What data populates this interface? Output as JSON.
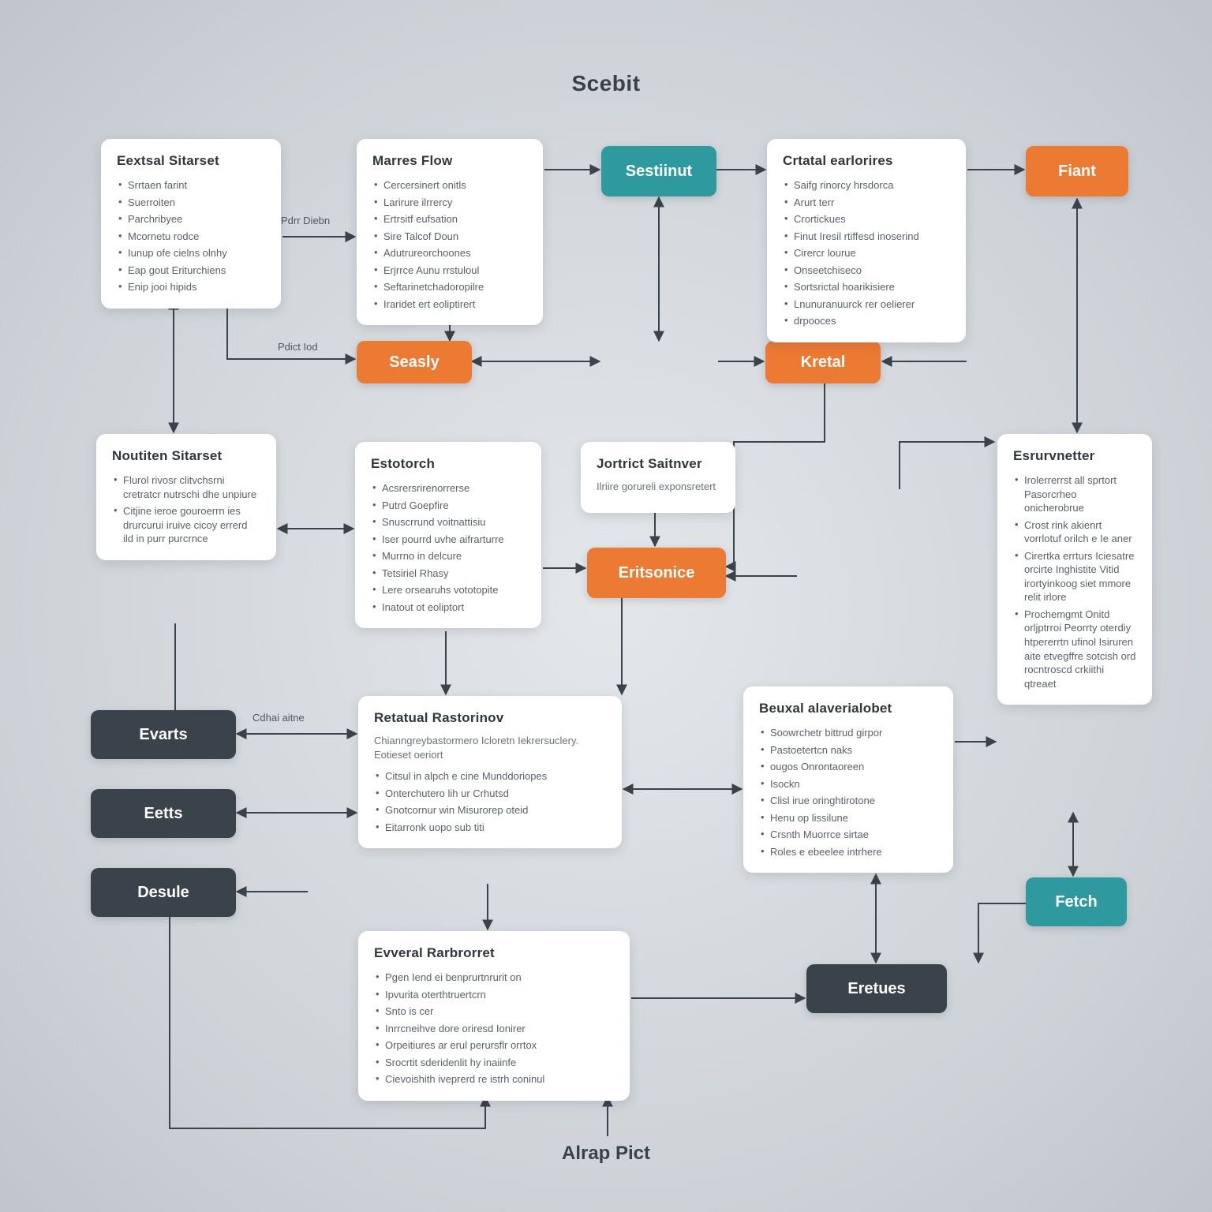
{
  "titles": {
    "top": "Scebit",
    "bottom": "Alrap Pict"
  },
  "edgeLabels": {
    "pdirDiebn": "Pdrr Diebn",
    "pdictIod": "Pdict Iod",
    "cdhaiAitne": "Cdhai aitne"
  },
  "chips": {
    "sestiinut": "Sestiinut",
    "fiant": "Fiant",
    "seasly": "Seasly",
    "kretal": "Kretal",
    "eritsonice": "Eritsonice",
    "evarts": "Evarts",
    "eetts": "Eetts",
    "desule": "Desule",
    "eretues": "Eretues",
    "fetch": "Fetch"
  },
  "cards": {
    "c1": {
      "title": "Eextsal Sitarset",
      "items": [
        "Srrtaen farint",
        "Suerroiten",
        "Parchribyee",
        "Mcornetu rodce",
        "Iunup ofe cielns olnhy",
        "Eap gout Eriturchiens",
        "Enip jooi hipids"
      ]
    },
    "c2": {
      "title": "Marres Flow",
      "items": [
        "Cercersinert onitls",
        "Larirure ilrrercy",
        "Ertrsitf eufsation",
        "Sire Talcof Doun",
        "Adutrureorchoones",
        "Erjrrce Aunu rrstuloul",
        "Seftarinetchadoropilre",
        "Iraridet ert eoliptirert"
      ]
    },
    "c3": {
      "title": "Crtatal earlorires",
      "items": [
        "Saifg rinorcy hrsdorca",
        "Arurt terr",
        "Crortickues",
        "Finut Iresil rtiffesd inoserind",
        "Cirercr lourue",
        "Onseetchiseco",
        "Sortsrictal hoarikisiere",
        "Lnunuranuurck rer oelierer",
        "drpooces"
      ]
    },
    "c4": {
      "title": "Noutiten Sitarset",
      "items": [
        "Flurol rivosr clitvchsrni cretratcr nutrschi dhe unpiure",
        "Citjine ieroe gouroerrn ies drurcurui iruive cicoy errerd ild in purr purcrnce"
      ]
    },
    "c5": {
      "title": "Estotorch",
      "items": [
        "Acsrersrirenorrerse",
        "Putrd Goepfire",
        "Snuscrrund voitnattisiu",
        "Iser pourrd uvhe aifrarturre",
        "Murrno in delcure",
        "Tetsiriel Rhasy",
        "Lere orsearuhs vototopite",
        "Inatout ot eoliptort"
      ]
    },
    "c6": {
      "title": "Jortrict Saitnver",
      "sub": "Ilriire gorureli exponsretert"
    },
    "c7": {
      "title": "Retatual Rastorinov",
      "sub": "Chianngreybastormero Icloretn Iekrersuclery. Eotieset oeriort",
      "items": [
        "Citsul in alpch e cine Munddoriopes",
        "Onterchutero lih ur Crhutsd",
        "Gnotcornur win Misurorep oteid",
        "Eitarronk uopo sub titi"
      ]
    },
    "c8": {
      "title": "Beuxal alaverialobet",
      "items": [
        "Soowrchetr bittrud girpor",
        "Pastoetertcn naks",
        "ougos Onrontaoreen",
        "Isockn",
        "Clisl irue oringhtirotone",
        "Henu op lissilune",
        "Crsnth Muorrce sirtae",
        "Roles e ebeelee intrhere"
      ]
    },
    "c9": {
      "title": "Esrurvnetter",
      "items": [
        "Irolerrerrst all sprtort Pasorcrheo onicherobrue",
        "Crost rink akienrt vorrlotuf orilch e Ie aner",
        "Cirertka errturs Iciesatre orcirte Inghistite Vitid irortyinkoog siet mmore relit irlore",
        "Prochemgmt Onitd orljptrroi Peorrty oterdiy htpererrtn ufinol Isiruren aite etvegffre sotcish ord rocntroscd crkiithi qtreaet"
      ]
    },
    "c10": {
      "title": "Evveral Rarbrorret",
      "items": [
        "Pgen Iend ei benprurtnrurit on",
        "Ipvurita oterthtruertcrn",
        "Snto is cer",
        "Inrrcneihve dore oriresd Ionirer",
        "Orpeitiures ar erul perursflr orrtox",
        "Srocrtit sderidenlit hy inaiinfe",
        "Cievoishith iveprerd re istrh coninul"
      ]
    }
  }
}
